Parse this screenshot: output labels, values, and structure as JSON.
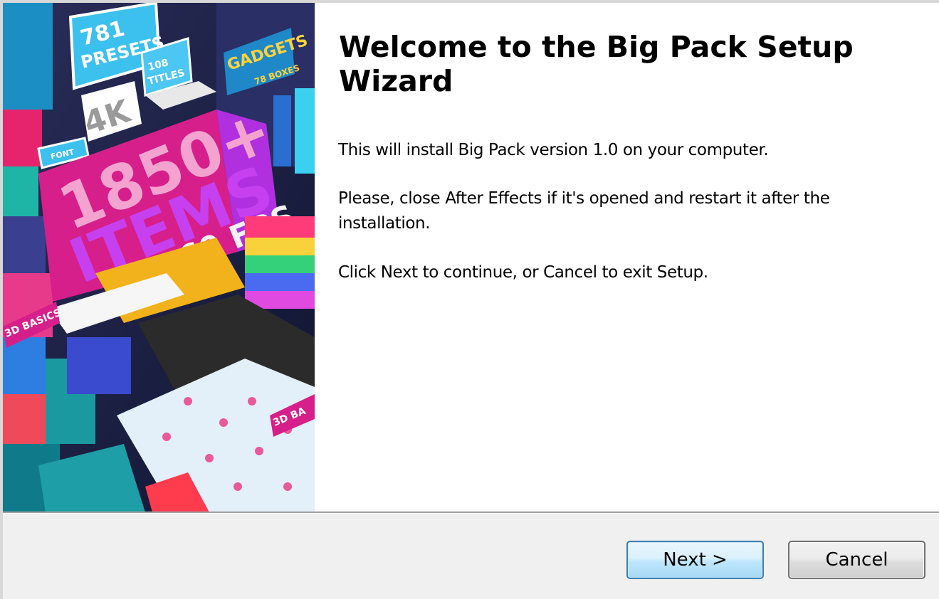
{
  "wizard": {
    "title": "Welcome to the Big Pack Setup Wizard",
    "paragraphs": [
      "This will install Big Pack version 1.0 on your computer.",
      "Please, close After Effects if it's opened and restart it after the installation.",
      "Click Next to continue, or Cancel to exit Setup."
    ]
  },
  "banner": {
    "presets_count": "781",
    "presets_label": "PRESETS",
    "titles_count": "108",
    "titles_label": "TITLES",
    "gadgets_label": "GADGETS",
    "gadgets_count": "78 BOXES",
    "resolution": "4K",
    "font_label": "FONT",
    "items_count": "1850+",
    "items_label": "ITEMS",
    "fps_label": "60 FPS",
    "basics_label": "3D BASICS",
    "basics_label_2": "3D BA"
  },
  "buttons": {
    "next_label": "Next >",
    "cancel_label": "Cancel"
  },
  "colors": {
    "accent_button_border": "#3c7fb1",
    "banner_magenta": "#d61f8a",
    "banner_purple": "#b030e0",
    "banner_cyan": "#2fb8e8"
  }
}
